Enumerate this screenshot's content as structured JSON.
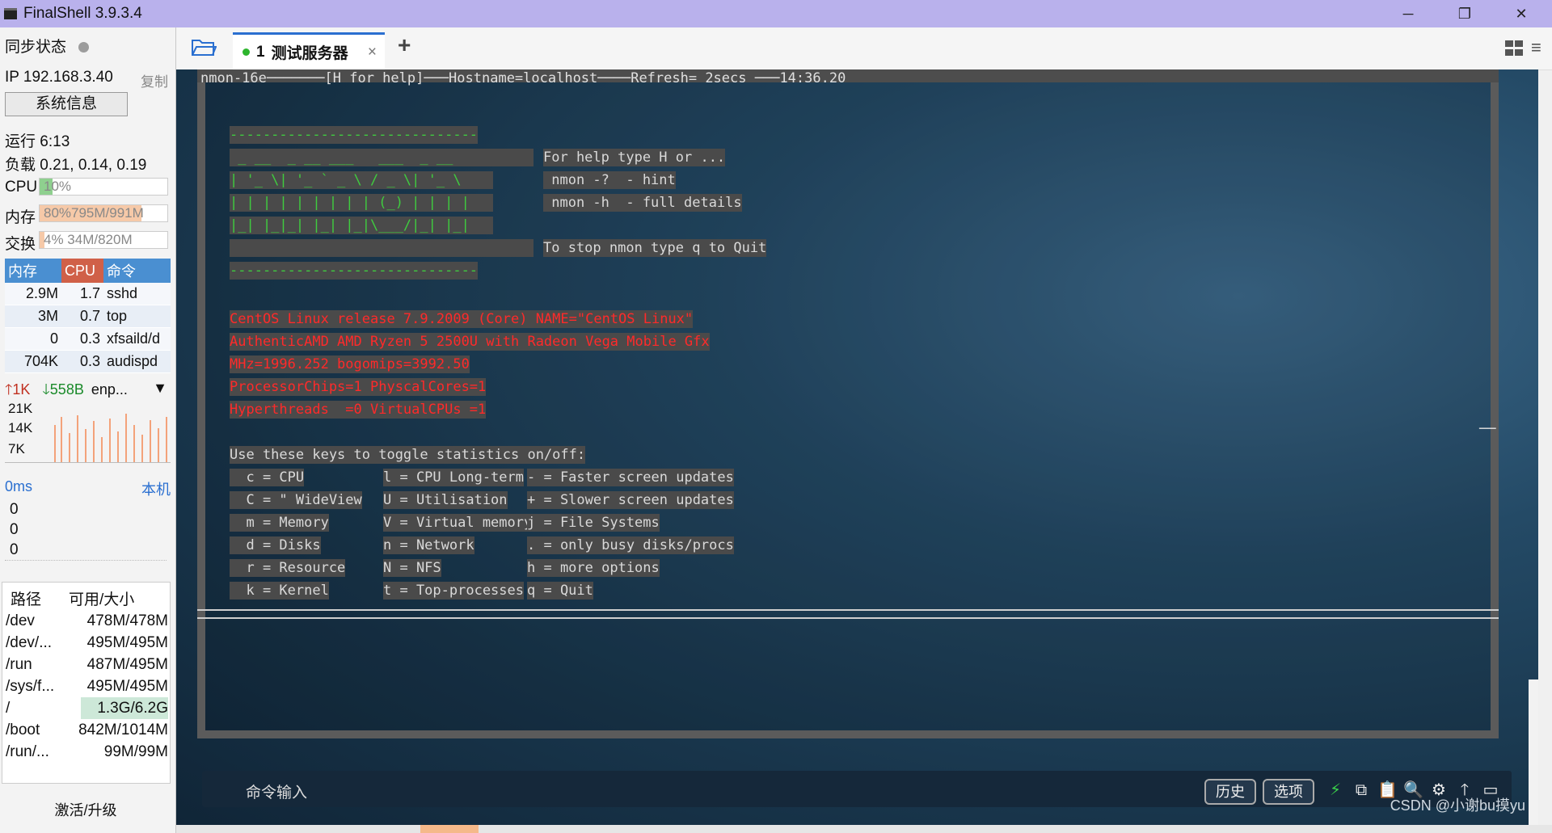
{
  "window": {
    "title": "FinalShell 3.9.3.4",
    "minimize": "─",
    "maximize": "❐",
    "close": "✕"
  },
  "sidebar": {
    "sync_label": "同步状态",
    "ip": "IP 192.168.3.40",
    "copy": "复制",
    "sysinfo": "系统信息",
    "uptime": "运行 6:13",
    "load": "负载 0.21, 0.14, 0.19",
    "cpu": {
      "label": "CPU",
      "text": "10%",
      "percent": 10,
      "color": "#8fd08f"
    },
    "mem": {
      "label": "内存",
      "text": "80%795M/991M",
      "percent": 80,
      "color": "#f6c9a8"
    },
    "swap": {
      "label": "交换",
      "text": "4%     34M/820M",
      "percent": 4,
      "color": "#f6c9a8"
    },
    "proc_headers": [
      "内存",
      "CPU",
      "命令"
    ],
    "processes": [
      {
        "mem": "2.9M",
        "cpu": "1.7",
        "cmd": "sshd"
      },
      {
        "mem": "3M",
        "cpu": "0.7",
        "cmd": "top"
      },
      {
        "mem": "0",
        "cpu": "0.3",
        "cmd": "xfsaild/d"
      },
      {
        "mem": "704K",
        "cpu": "0.3",
        "cmd": "audispd"
      }
    ],
    "net": {
      "up": "1K",
      "down": "558B",
      "iface": "enp...",
      "scale": [
        "21K",
        "14K",
        "7K"
      ]
    },
    "ping": {
      "label": "0ms",
      "host": "本机",
      "values": [
        "0",
        "0",
        "0"
      ]
    },
    "disk_headers": [
      "路径",
      "可用/大小"
    ],
    "disks": [
      {
        "path": "/dev",
        "size": "478M/478M"
      },
      {
        "path": "/dev/...",
        "size": "495M/495M"
      },
      {
        "path": "/run",
        "size": "487M/495M"
      },
      {
        "path": "/sys/f...",
        "size": "495M/495M"
      },
      {
        "path": "/",
        "size": "1.3G/6.2G"
      },
      {
        "path": "/boot",
        "size": "842M/1014M"
      },
      {
        "path": "/run/...",
        "size": "99M/99M"
      }
    ],
    "activate": "激活/升级"
  },
  "tabs": {
    "active_num": "1",
    "active_label": "测试服务器",
    "close": "×",
    "add": "+"
  },
  "terminal": {
    "header": "nmon-16e───────[H for help]───Hostname=localhost────Refresh= 2secs ───14:36.20",
    "dashes": "------------------------------",
    "logo": [
      " _ __  _ __ ___   ___  _ __  ",
      "| '_ \\| '_ ` _ \\ / _ \\| '_ \\ ",
      "| | | | | | | | | (_) | | | |",
      "|_| |_|_| |_| |_|\\___/|_| |_|"
    ],
    "help": [
      "For help type H or ...",
      " nmon -?  - hint",
      " nmon -h  - full details",
      "",
      "To stop nmon type q to Quit"
    ],
    "sysinfo": [
      "CentOS Linux release 7.9.2009 (Core) NAME=\"CentOS Linux\"",
      "AuthenticAMD AMD Ryzen 5 2500U with Radeon Vega Mobile Gfx",
      "MHz=1996.252 bogomips=3992.50",
      "ProcessorChips=1 PhyscalCores=1",
      "Hyperthreads  =0 VirtualCPUs =1"
    ],
    "keys_title": "Use these keys to toggle statistics on/off:",
    "keys": [
      [
        "  c = CPU",
        "l = CPU Long-term",
        "- = Faster screen updates"
      ],
      [
        "  C = \" WideView",
        "U = Utilisation",
        "+ = Slower screen updates"
      ],
      [
        "  m = Memory",
        "V = Virtual memory",
        "j = File Systems"
      ],
      [
        "  d = Disks",
        "n = Network",
        ". = only busy disks/procs"
      ],
      [
        "  r = Resource",
        "N = NFS",
        "h = more options"
      ],
      [
        "  k = Kernel",
        "t = Top-processes",
        "q = Quit"
      ]
    ]
  },
  "cmdbar": {
    "placeholder": "命令输入",
    "history": "历史",
    "options": "选项",
    "watermark": "CSDN @小谢bu摸yu"
  }
}
